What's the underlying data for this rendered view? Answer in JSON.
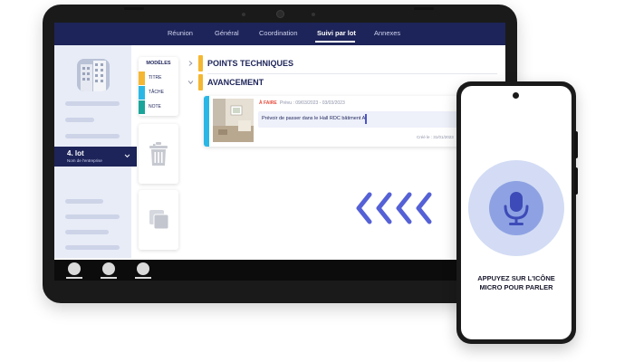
{
  "tablet": {
    "tabs": [
      {
        "label": "Réunion"
      },
      {
        "label": "Général"
      },
      {
        "label": "Coordination"
      },
      {
        "label": "Suivi par lot",
        "active": true
      },
      {
        "label": "Annexes"
      }
    ],
    "sidebar": {
      "lot": {
        "title": "4. lot",
        "subtitle": "Nom de l'entreprise"
      },
      "icons": {
        "project": "building-photo",
        "dropdown": "chevron-down-icon"
      }
    },
    "tools": {
      "title": "MODÈLES",
      "items": [
        {
          "label": "TITRE",
          "color": "#f5b731"
        },
        {
          "label": "TÂCHE",
          "color": "#2ab7e6"
        },
        {
          "label": "NOTE",
          "color": "#1aa59a"
        }
      ],
      "delete_icon": "trash-icon",
      "duplicate_icon": "copy-icon"
    },
    "sections": [
      {
        "label": "POINTS TECHNIQUES",
        "color": "#f5b731",
        "expanded": false
      },
      {
        "label": "AVANCEMENT",
        "color": "#f5b731",
        "expanded": true
      }
    ],
    "task": {
      "status": "À FAIRE",
      "dates": "Prévu : 09/03/2023 - 03/03/2023",
      "text": "Prévoir de passer dans le Hall RDC bâtiment A",
      "meta": "Créé le : 31/01/2023",
      "status_color": "#e64b3c",
      "accent_color": "#2ab7e6"
    },
    "arrows_color": "#5561d6",
    "nav_color": "#1d2459"
  },
  "phone": {
    "caption_line1": "APPUYEZ SUR L'ICÔNE",
    "caption_line2": "MICRO POUR PARLER",
    "icon": "microphone-icon",
    "accent_color": "#8ea2e3"
  }
}
